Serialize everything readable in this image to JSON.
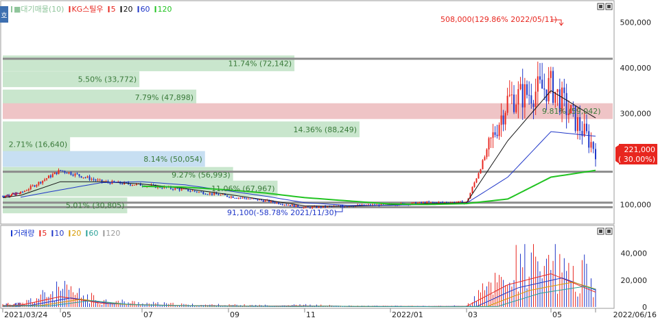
{
  "legend_price": {
    "items": [
      {
        "label": "■대기매물(10)",
        "color": "#8fc59b"
      },
      {
        "label": "KG스틸우",
        "color": "#e8261f"
      },
      {
        "label": "5",
        "color": "#e8261f"
      },
      {
        "label": "20",
        "color": "#111111"
      },
      {
        "label": "60",
        "color": "#1f36c8"
      },
      {
        "label": "120",
        "color": "#21c321"
      }
    ]
  },
  "legend_volume": {
    "items": [
      {
        "label": "거래량",
        "color": "#1a3ad0"
      },
      {
        "label": "5",
        "color": "#e8261f"
      },
      {
        "label": "10",
        "color": "#1f36c8"
      },
      {
        "label": "20",
        "color": "#d69a00"
      },
      {
        "label": "60",
        "color": "#2aa198"
      },
      {
        "label": "120",
        "color": "#9a9a9a"
      }
    ]
  },
  "side_tab_label": "호",
  "current_price": {
    "price": "221,000",
    "change": "( 30.00%)"
  },
  "annotations": {
    "high": "508,000(129.86% 2022/05/11)",
    "low": "91,100(-58.78% 2021/11/30)"
  },
  "colors": {
    "up": "#e8261f",
    "down": "#1f36c8",
    "ma20": "#111111",
    "ma60": "#1f36c8",
    "ma120": "#21c321",
    "supply_green": "#c9e6cd",
    "supply_blue": "#c7dff2",
    "supply_red": "#efc4c6"
  },
  "chart_data": [
    {
      "type": "bar",
      "title": "대기매물(10)",
      "orientation": "horizontal",
      "price_buckets": [
        410000,
        375000,
        335000,
        305000,
        265000,
        232000,
        200000,
        165000,
        135000,
        98000
      ],
      "labels": [
        "11.74% (72,142)",
        "5.50% (33,772)",
        "7.79% (47,898)",
        "9.81% (59,042)",
        "14.36% (88,249)",
        "2.71% (16,640)",
        "8.14% (50,054)",
        "9.27% (56,993)",
        "11.06% (67,967)",
        "5.01% (30,805)"
      ],
      "percent": [
        11.74,
        5.5,
        7.79,
        9.81,
        14.36,
        2.71,
        8.14,
        9.27,
        11.06,
        5.01
      ],
      "volume": [
        72142,
        33772,
        47898,
        59042,
        88249,
        16640,
        50054,
        56993,
        67967,
        30805
      ],
      "highlight": {
        "current": 3,
        "blue": 6
      }
    },
    {
      "type": "line",
      "title": "KG스틸우",
      "x": [
        "2021/03",
        "2021/04",
        "2021/05",
        "2021/06",
        "2021/07",
        "2021/08",
        "2021/09",
        "2021/10",
        "2021/11",
        "2021/12",
        "2022/01",
        "2022/02",
        "2022/03",
        "2022/04",
        "2022/05",
        "2022/06"
      ],
      "close": [
        118000,
        125000,
        175000,
        150000,
        143000,
        132000,
        118000,
        108000,
        93000,
        97000,
        100000,
        104000,
        105000,
        330000,
        360000,
        221000
      ],
      "series": [
        {
          "name": "20",
          "values": [
            115000,
            120000,
            150000,
            150000,
            145000,
            135000,
            122000,
            110000,
            97000,
            96000,
            99000,
            102000,
            104000,
            240000,
            350000,
            290000
          ]
        },
        {
          "name": "60",
          "values": [
            null,
            116000,
            132000,
            148000,
            150000,
            143000,
            130000,
            118000,
            104000,
            98000,
            98000,
            100000,
            103000,
            160000,
            260000,
            250000
          ]
        },
        {
          "name": "120",
          "values": [
            null,
            null,
            null,
            null,
            140000,
            138000,
            132000,
            125000,
            115000,
            108000,
            101000,
            100000,
            102000,
            112000,
            160000,
            175000
          ]
        }
      ],
      "ylim": [
        60000,
        540000
      ],
      "yticks": [
        "100,000",
        "200,000",
        "300,000",
        "400,000",
        "500,000"
      ],
      "ytick_values": [
        100000,
        200000,
        300000,
        400000,
        500000
      ],
      "hlines": [
        420000,
        172000,
        104000,
        94000
      ],
      "xticks": [
        "2021/03/24",
        "05",
        "07",
        "09",
        "11",
        "2022/01",
        "03",
        "05",
        "2022/06/16"
      ]
    },
    {
      "type": "bar",
      "title": "거래량",
      "x": [
        "2021/03",
        "2021/04",
        "2021/05",
        "2021/06",
        "2021/07",
        "2021/08",
        "2021/09",
        "2021/10",
        "2021/11",
        "2021/12",
        "2022/01",
        "2022/02",
        "2022/03",
        "2022/04",
        "2022/05",
        "2022/06"
      ],
      "values": [
        2000,
        2500,
        14000,
        5000,
        3000,
        1800,
        1500,
        1200,
        1500,
        800,
        700,
        600,
        900,
        30000,
        45000,
        20000
      ],
      "ylim": [
        0,
        52000
      ],
      "yticks": [
        "0",
        "20,000",
        "40,000"
      ],
      "ytick_values": [
        0,
        20000,
        40000
      ]
    }
  ]
}
